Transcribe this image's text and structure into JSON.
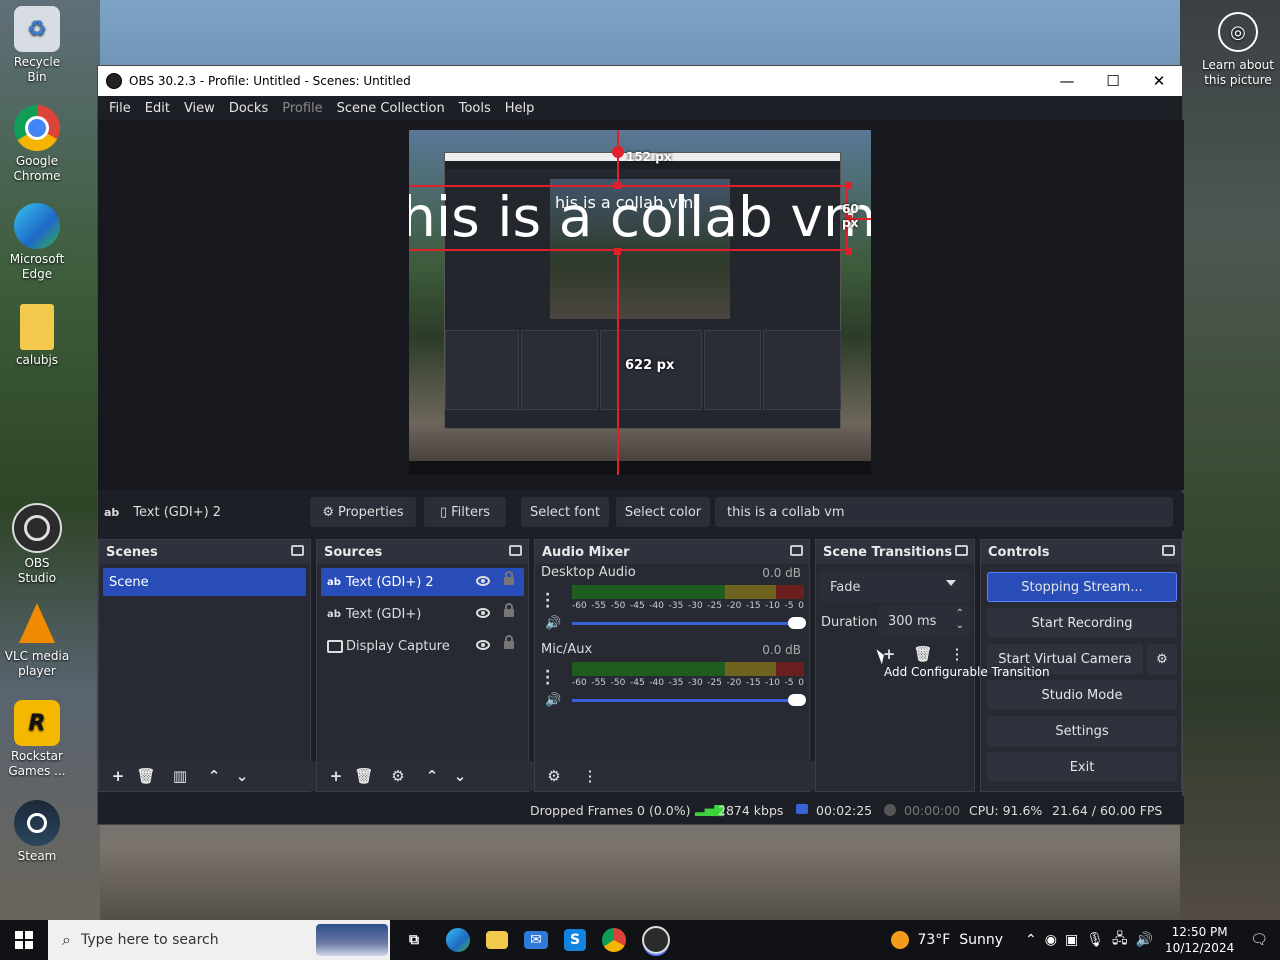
{
  "desktop": {
    "icons": [
      {
        "label": "Recycle Bin",
        "icon": "recycle-bin-icon"
      },
      {
        "label": "Google Chrome",
        "icon": "chrome-icon"
      },
      {
        "label": "Microsoft Edge",
        "icon": "edge-icon"
      },
      {
        "label": "calubjs",
        "icon": "folder-icon"
      },
      {
        "label": "OBS Studio",
        "icon": "obs-icon"
      },
      {
        "label": "VLC media player",
        "icon": "vlc-icon"
      },
      {
        "label": "Rockstar Games ...",
        "icon": "rockstar-icon"
      },
      {
        "label": "Steam",
        "icon": "steam-icon"
      }
    ],
    "learn_about": "Learn about this picture"
  },
  "window": {
    "title": "OBS 30.2.3 - Profile: Untitled - Scenes: Untitled",
    "menu": [
      "File",
      "Edit",
      "View",
      "Docks",
      "Profile",
      "Scene Collection",
      "Tools",
      "Help"
    ],
    "disabled_menu": "Profile"
  },
  "preview": {
    "overlay_text": "his is a collab vm",
    "nested_text": "his is a collab vm",
    "px_top": "152 px",
    "px_right": "60 px",
    "px_bottom": "622 px"
  },
  "source_toolbar": {
    "source_name": "Text (GDI+) 2",
    "properties": "Properties",
    "filters": "Filters",
    "select_font": "Select font",
    "select_color": "Select color",
    "text_value": "this is a collab vm"
  },
  "scenes": {
    "title": "Scenes",
    "items": [
      "Scene"
    ]
  },
  "sources": {
    "title": "Sources",
    "items": [
      "Text (GDI+) 2",
      "Text (GDI+)",
      "Display Capture"
    ]
  },
  "mixer": {
    "title": "Audio Mixer",
    "channels": [
      {
        "name": "Desktop Audio",
        "db": "0.0 dB"
      },
      {
        "name": "Mic/Aux",
        "db": "0.0 dB"
      }
    ],
    "scale": [
      "-60",
      "-55",
      "-50",
      "-45",
      "-40",
      "-35",
      "-30",
      "-25",
      "-20",
      "-15",
      "-10",
      "-5",
      "0"
    ]
  },
  "transitions": {
    "title": "Scene Transitions",
    "selected": "Fade",
    "duration_label": "Duration",
    "duration_value": "300 ms",
    "tooltip": "Add Configurable Transition"
  },
  "controls": {
    "title": "Controls",
    "buttons": [
      "Stopping Stream...",
      "Start Recording",
      "Start Virtual Camera",
      "Studio Mode",
      "Settings",
      "Exit"
    ]
  },
  "status": {
    "dropped": "Dropped Frames 0 (0.0%)",
    "bitrate": "2874 kbps",
    "stream_time": "00:02:25",
    "rec_time": "00:00:00",
    "cpu": "CPU: 91.6%",
    "fps": "21.64 / 60.00 FPS"
  },
  "taskbar": {
    "search_placeholder": "Type here to search",
    "weather": "73°F  Sunny",
    "time": "12:50 PM",
    "date": "10/12/2024"
  },
  "colors": {
    "accent": "#284cb8",
    "bbox_red": "#e0202a"
  }
}
